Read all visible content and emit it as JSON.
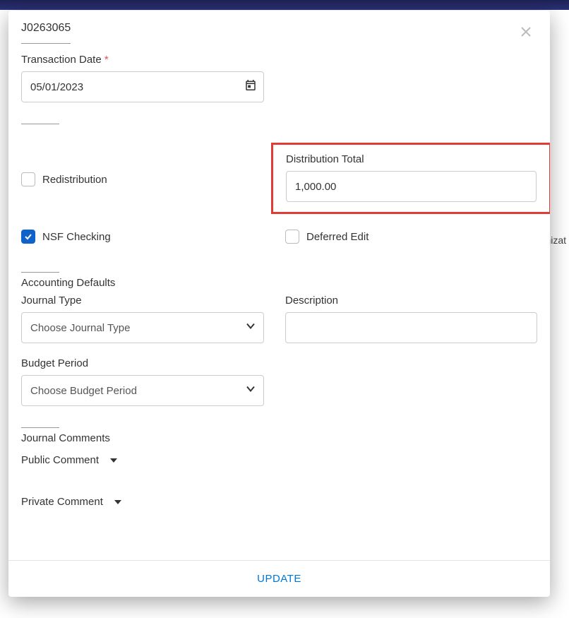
{
  "bg_text": "nizat",
  "modal": {
    "title": "J0263065",
    "update_label": "UPDATE"
  },
  "transaction_date": {
    "label": "Transaction Date",
    "value": "05/01/2023"
  },
  "distribution_total": {
    "label": "Distribution Total",
    "value": "1,000.00"
  },
  "checkboxes": {
    "redistribution": {
      "label": "Redistribution",
      "checked": false
    },
    "nsf_checking": {
      "label": "NSF Checking",
      "checked": true
    },
    "deferred_edit": {
      "label": "Deferred Edit",
      "checked": false
    }
  },
  "accounting_defaults": {
    "heading": "Accounting Defaults",
    "journal_type": {
      "label": "Journal Type",
      "placeholder": "Choose Journal Type"
    },
    "description": {
      "label": "Description",
      "value": ""
    },
    "budget_period": {
      "label": "Budget Period",
      "placeholder": "Choose Budget Period"
    }
  },
  "journal_comments": {
    "heading": "Journal Comments",
    "public": "Public Comment",
    "private": "Private Comment"
  }
}
